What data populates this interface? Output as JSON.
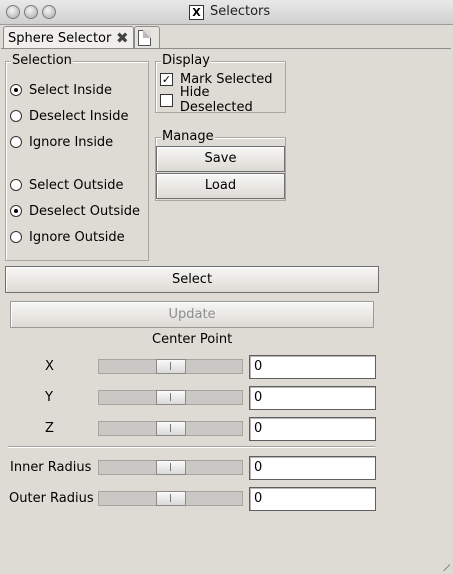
{
  "window": {
    "title": "Selectors"
  },
  "tabs": [
    {
      "label": "Sphere Selector"
    }
  ],
  "selection": {
    "title": "Selection",
    "options": [
      {
        "label": "Select Inside",
        "checked": true
      },
      {
        "label": "Deselect Inside",
        "checked": false
      },
      {
        "label": "Ignore Inside",
        "checked": false
      },
      {
        "label": "Select Outside",
        "checked": false
      },
      {
        "label": "Deselect Outside",
        "checked": true
      },
      {
        "label": "Ignore Outside",
        "checked": false
      }
    ]
  },
  "display": {
    "title": "Display",
    "options": [
      {
        "label": "Mark Selected",
        "checked": true
      },
      {
        "label": "Hide Deselected",
        "checked": false
      }
    ]
  },
  "manage": {
    "title": "Manage",
    "save_label": "Save",
    "load_label": "Load"
  },
  "select_label": "Select",
  "update_label": "Update",
  "center": {
    "title": "Center Point",
    "fields": [
      {
        "label": "X",
        "value": "0",
        "slider_fraction": 0.5
      },
      {
        "label": "Y",
        "value": "0",
        "slider_fraction": 0.5
      },
      {
        "label": "Z",
        "value": "0",
        "slider_fraction": 0.5
      }
    ]
  },
  "radius": {
    "fields": [
      {
        "label": "Inner Radius",
        "value": "0",
        "slider_fraction": 0.5
      },
      {
        "label": "Outer Radius",
        "value": "0",
        "slider_fraction": 0.5
      }
    ]
  }
}
